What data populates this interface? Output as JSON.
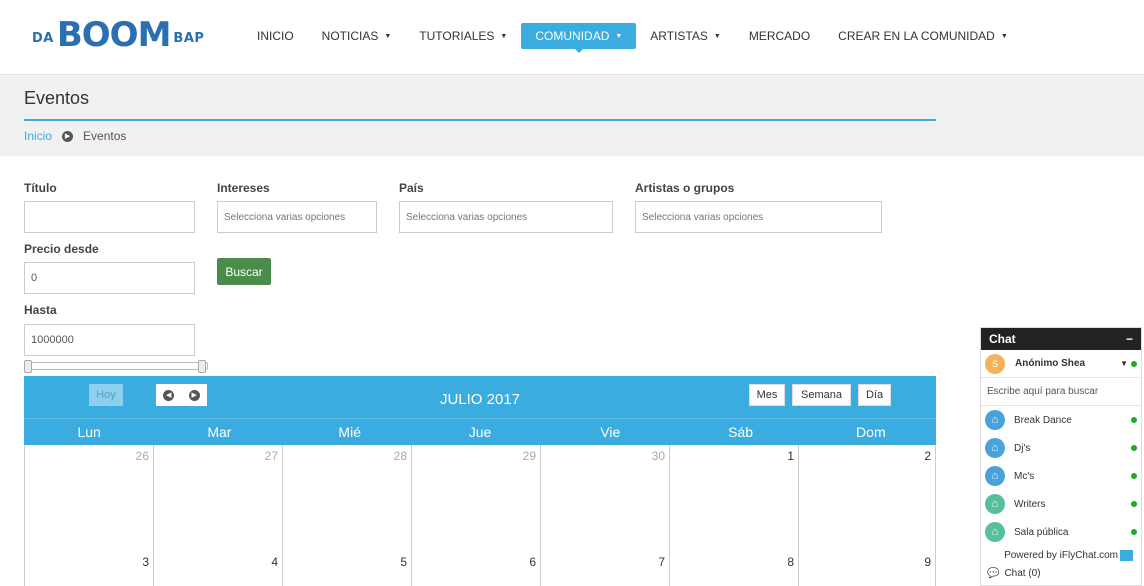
{
  "brand": {
    "pre": "DA",
    "main": "BOOM",
    "post": "BAP"
  },
  "nav": {
    "items": [
      {
        "label": "INICIO",
        "caret": ""
      },
      {
        "label": "NOTICIAS",
        "caret": "▼"
      },
      {
        "label": "TUTORIALES",
        "caret": "▼"
      },
      {
        "label": "COMUNIDAD",
        "caret": "▼"
      },
      {
        "label": "ARTISTAS",
        "caret": "▼"
      },
      {
        "label": "MERCADO",
        "caret": ""
      },
      {
        "label": "CREAR EN LA COMUNIDAD",
        "caret": "▼"
      }
    ],
    "active_index": 3
  },
  "page": {
    "title": "Eventos"
  },
  "breadcrumb": {
    "home": "Inicio",
    "current": "Eventos"
  },
  "filters": {
    "titulo_label": "Título",
    "titulo_value": "",
    "intereses_label": "Intereses",
    "intereses_placeholder": "Selecciona varias opciones",
    "pais_label": "País",
    "pais_placeholder": "Selecciona varias opciones",
    "artistas_label": "Artistas o grupos",
    "artistas_placeholder": "Selecciona varias opciones",
    "precio_desde_label": "Precio desde",
    "precio_desde_value": "0",
    "hasta_label": "Hasta",
    "hasta_value": "1000000",
    "buscar_label": "Buscar"
  },
  "calendar": {
    "today_label": "Hoy",
    "title": "JULIO 2017",
    "views": [
      "Mes",
      "Semana",
      "Día"
    ],
    "weekdays": [
      "Lun",
      "Mar",
      "Mié",
      "Jue",
      "Vie",
      "Sáb",
      "Dom"
    ],
    "week1": [
      "26",
      "27",
      "28",
      "29",
      "30",
      "1",
      "2"
    ],
    "week2": [
      "3",
      "4",
      "5",
      "6",
      "7",
      "8",
      "9"
    ]
  },
  "chat": {
    "title": "Chat",
    "minimize": "−",
    "user": {
      "initial": "S",
      "name": "Anónimo Shea"
    },
    "search_placeholder": "Escribe aquí para buscar",
    "rooms": [
      {
        "name": "Break Dance",
        "color": "#4aa3d8"
      },
      {
        "name": "Dj's",
        "color": "#4aa3d8"
      },
      {
        "name": "Mc's",
        "color": "#4aa3d8"
      },
      {
        "name": "Writers",
        "color": "#57bf9a"
      },
      {
        "name": "Sala pública",
        "color": "#57bf9a"
      }
    ],
    "powered_by": "Powered by iFlyChat.com",
    "footer": "Chat (0)"
  },
  "colors": {
    "accent": "#3aacdf",
    "button_green": "#4a8d4a",
    "online": "#22aa22"
  }
}
